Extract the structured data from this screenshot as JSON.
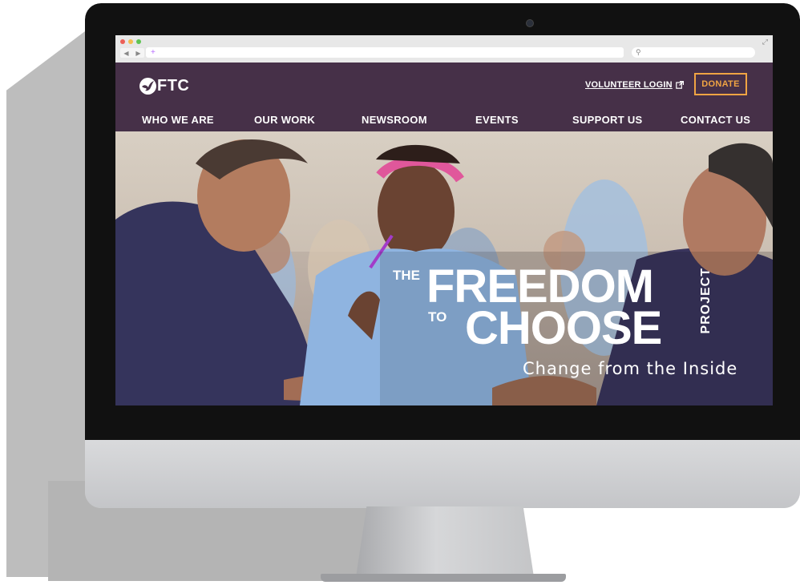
{
  "browser": {
    "url_glyph": "+",
    "nav_back": "◀",
    "nav_forward": "▶",
    "search_glyph": "⚲",
    "expand_glyph": "⤢"
  },
  "site": {
    "logo_text": "FTC",
    "volunteer_login": "VOLUNTEER LOGIN",
    "donate": "DONATE",
    "nav": [
      "WHO WE ARE",
      "OUR WORK",
      "NEWSROOM",
      "EVENTS",
      "SUPPORT US",
      "CONTACT US"
    ]
  },
  "hero": {
    "the": "THE",
    "freedom": "FREEDOM",
    "to": "TO",
    "choose": "CHOOSE",
    "project": "PROJECT",
    "tagline": "Change from the Inside"
  },
  "colors": {
    "header_bg": "#463048",
    "donate_accent": "#f0a443",
    "text_on_header": "#ffffff"
  }
}
